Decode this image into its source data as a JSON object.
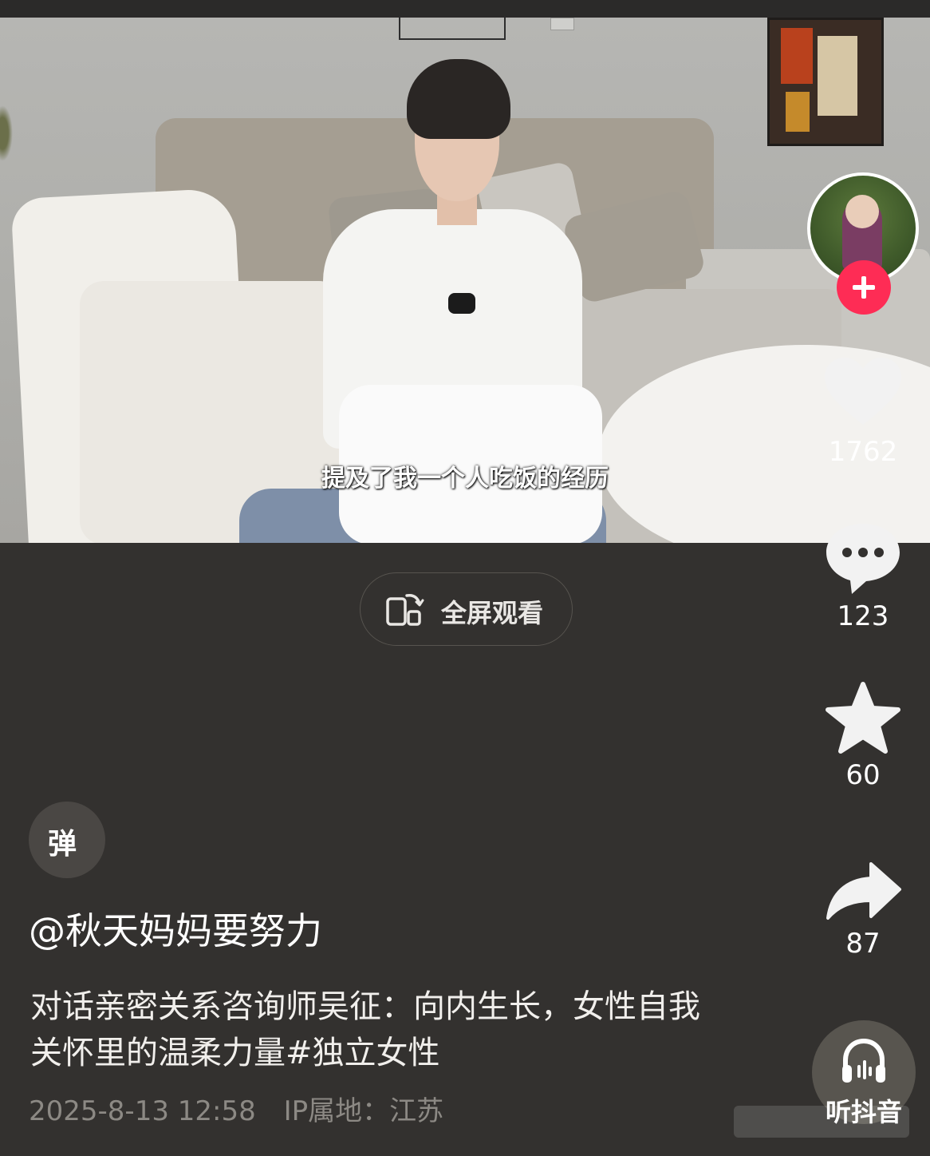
{
  "video": {
    "subtitle": "提及了我一个人吃饭的经历"
  },
  "fullscreen": {
    "label": "全屏观看",
    "icon": "rotate-phone-icon"
  },
  "actions": {
    "like_count": "1762",
    "comment_count": "123",
    "favorite_count": "60",
    "share_count": "87",
    "listen_label": "听抖音"
  },
  "danmu": {
    "label": "弹"
  },
  "post": {
    "author": "@秋天妈妈要努力",
    "description": "对话亲密关系咨询师吴征：向内生长，女性自我关怀里的温柔力量#独立女性",
    "date": "2025-8-13 12:58",
    "ip_location": "IP属地：江苏"
  },
  "colors": {
    "background": "#33312f",
    "follow_accent": "#fe2c55"
  }
}
